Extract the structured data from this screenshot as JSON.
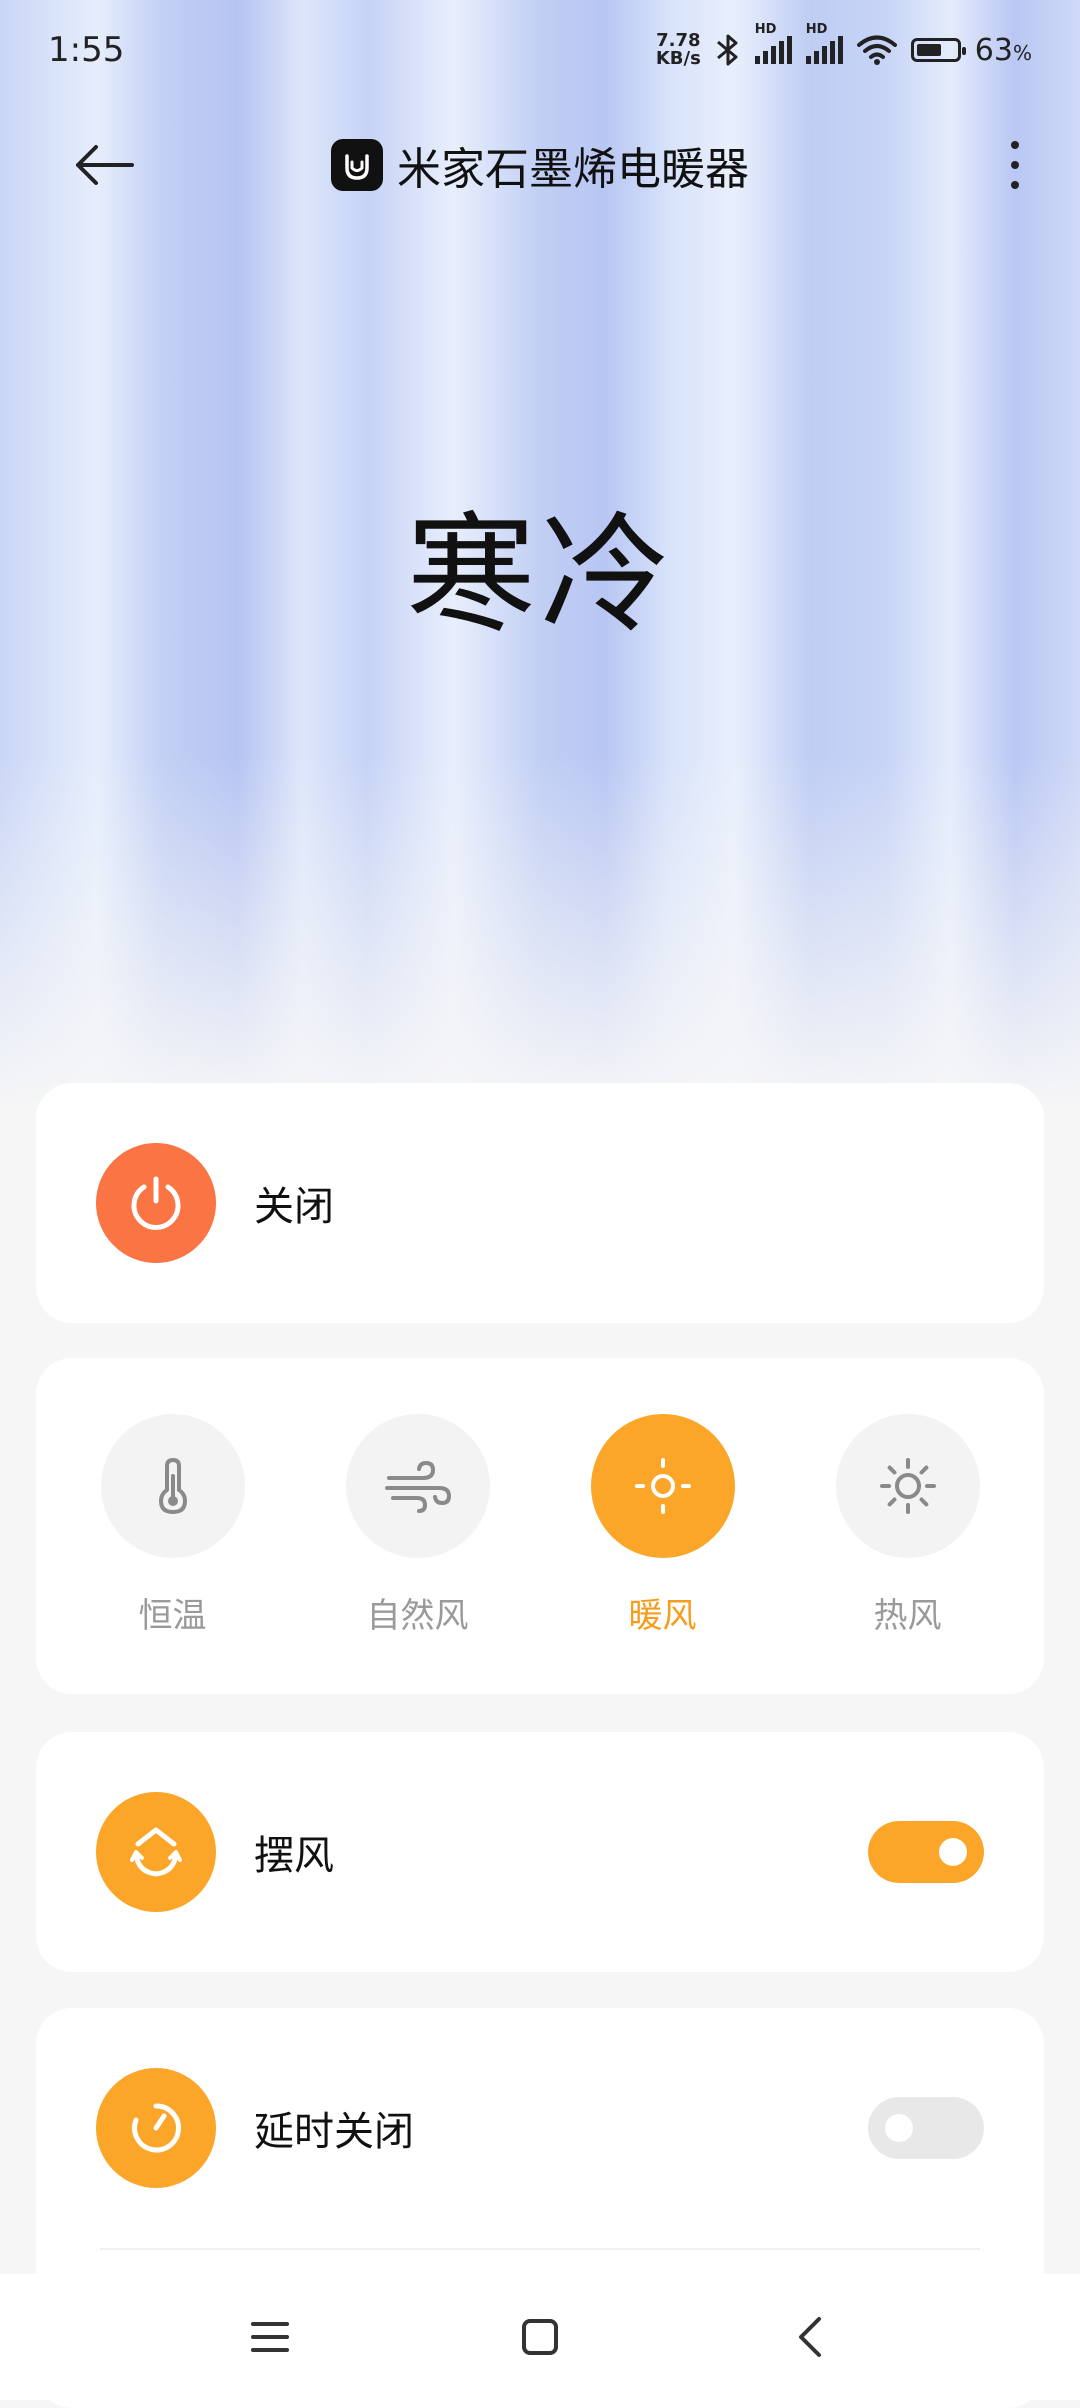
{
  "status_bar": {
    "time": "1:55",
    "net_speed_value": "7.78",
    "net_speed_unit": "KB/s",
    "hd1": "HD",
    "hd2": "HD",
    "battery_percent": "63",
    "battery_level": 0.63
  },
  "header": {
    "title": "米家石墨烯电暖器"
  },
  "hero": {
    "status_text": "寒冷"
  },
  "power": {
    "label": "关闭",
    "color": "#fb7443"
  },
  "modes": {
    "items": [
      {
        "label": "恒温",
        "icon": "thermometer-icon",
        "active": false
      },
      {
        "label": "自然风",
        "icon": "wind-icon",
        "active": false
      },
      {
        "label": "暖风",
        "icon": "sun-small-icon",
        "active": true
      },
      {
        "label": "热风",
        "icon": "sun-icon",
        "active": false
      }
    ],
    "active_color": "#fba628"
  },
  "swing": {
    "label": "摆风",
    "enabled": true
  },
  "timer": {
    "label": "延时关闭",
    "enabled": false
  }
}
